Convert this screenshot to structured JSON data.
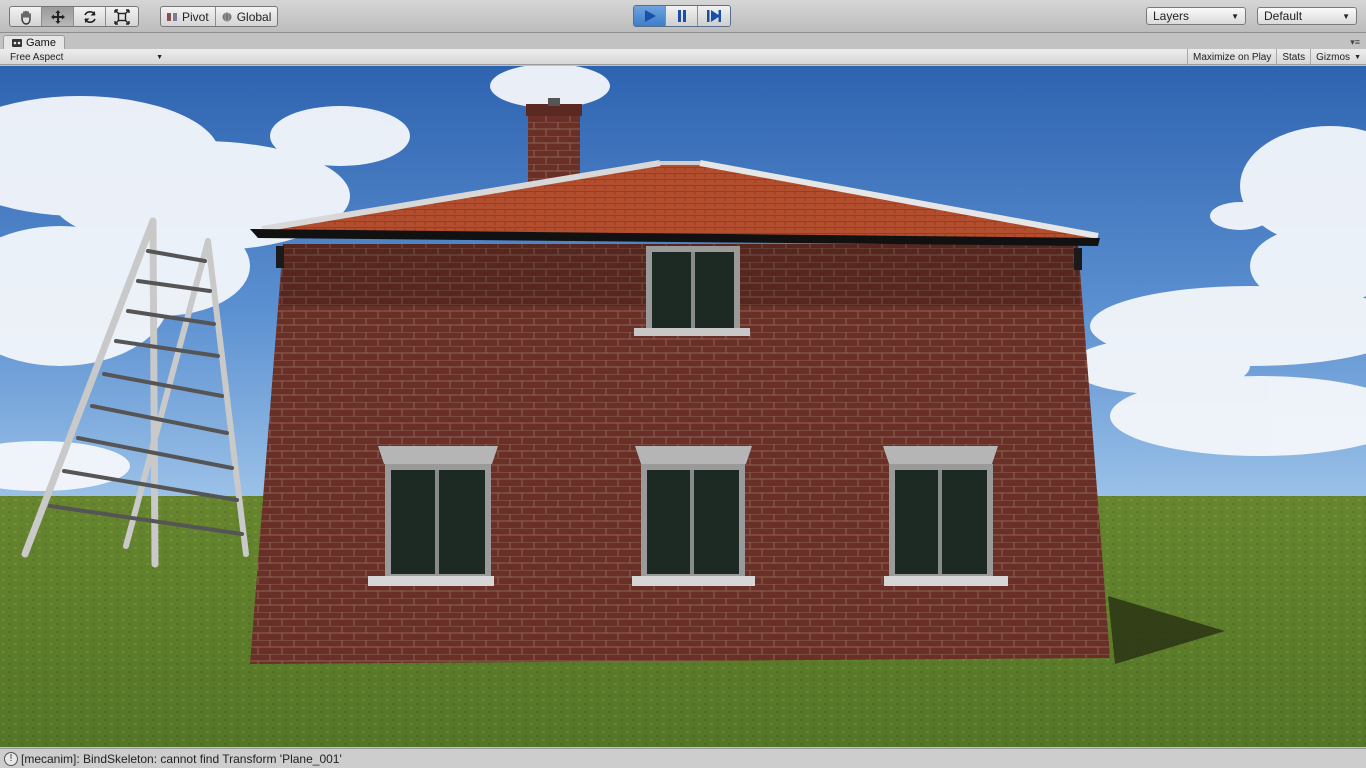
{
  "toolbar": {
    "transform_tools": [
      {
        "name": "hand-tool-button",
        "icon": "hand-icon",
        "active": false
      },
      {
        "name": "move-tool-button",
        "icon": "move-icon",
        "active": true
      },
      {
        "name": "rotate-tool-button",
        "icon": "rotate-icon",
        "active": false
      },
      {
        "name": "scale-tool-button",
        "icon": "scale-icon",
        "active": false
      }
    ],
    "pivot_label": "Pivot",
    "global_label": "Global",
    "play_controls": [
      {
        "name": "play-button",
        "icon": "play-icon",
        "active": true
      },
      {
        "name": "pause-button",
        "icon": "pause-icon",
        "active": false
      },
      {
        "name": "step-button",
        "icon": "step-icon",
        "active": false
      }
    ],
    "layers_label": "Layers",
    "layout_label": "Default"
  },
  "panel": {
    "tab_label": "Game",
    "aspect_label": "Free Aspect",
    "maximize_label": "Maximize on Play",
    "stats_label": "Stats",
    "gizmos_label": "Gizmos"
  },
  "status": {
    "message": "[mecanim]: BindSkeleton: cannot find Transform 'Plane_001'"
  },
  "colors": {
    "accent_blue": "#3e7dc7",
    "sky": "#3f70b6",
    "brick": "#6d3127",
    "roof": "#b5502f",
    "grass": "#5a7a2c"
  }
}
